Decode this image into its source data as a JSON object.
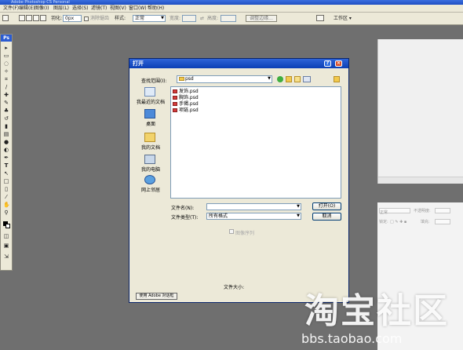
{
  "window": {
    "title": "Adobe Photoshop CS Personal"
  },
  "menu": [
    "文件(F)",
    "编辑(E)",
    "图像(I)",
    "图层(L)",
    "选择(S)",
    "滤镜(T)",
    "视图(V)",
    "窗口(W)",
    "帮助(H)"
  ],
  "options": {
    "feather_label": "羽化:",
    "feather_value": "0px",
    "antialias_label": "消除锯齿",
    "style_label": "样式:",
    "style_value": "正常",
    "width_label": "宽度:",
    "height_label": "高度:",
    "adjust_edge": "调整边缘...",
    "workspace": "工作区 ▾"
  },
  "toolbox": {
    "ps_logo": "Ps"
  },
  "dialog": {
    "title": "打开",
    "help_btn": "?",
    "close_btn": "×",
    "lookin_label": "查找范围(I):",
    "lookin_value": "psd",
    "places": [
      "我最近的文档",
      "桌面",
      "我的文档",
      "我的电脑",
      "网上邻居"
    ],
    "files": [
      "发饰.psd",
      "胸饰.psd",
      "手镯.psd",
      "项链.psd"
    ],
    "filename_label": "文件名(N):",
    "filename_value": "",
    "filetype_label": "文件类型(T):",
    "filetype_value": "所有格式",
    "open_btn": "打开(O)",
    "cancel_btn": "取消",
    "imagesequence": "图像序列",
    "filesize_label": "文件大小:",
    "bottom_btn": "使用 Adobe 对话框"
  },
  "panels": {
    "blend_mode": "正常",
    "opacity_label": "不透明度:",
    "lock_label": "锁定:",
    "fill_label": "填充:"
  },
  "watermark": {
    "main": "淘宝社区",
    "url": "bbs.taobao.com"
  }
}
